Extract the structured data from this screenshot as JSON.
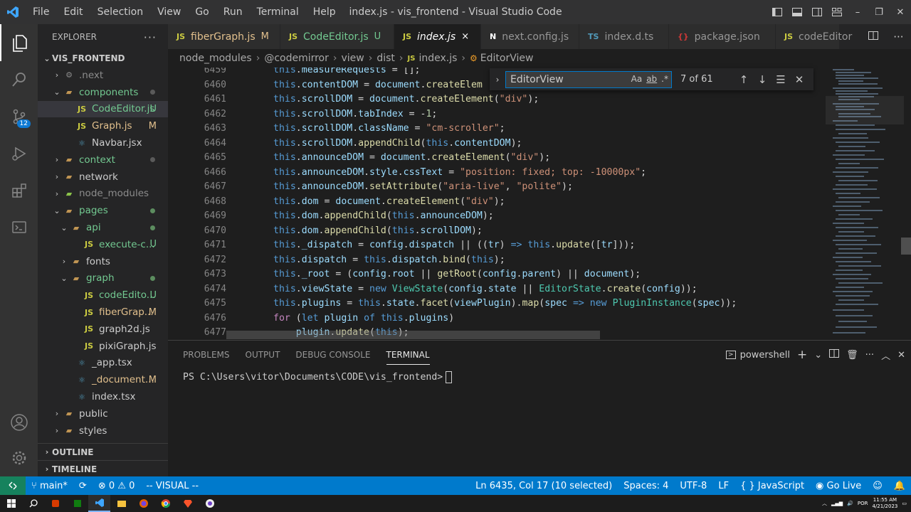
{
  "window": {
    "title": "index.js - vis_frontend - Visual Studio Code",
    "menu": [
      "File",
      "Edit",
      "Selection",
      "View",
      "Go",
      "Run",
      "Terminal",
      "Help"
    ]
  },
  "activity": {
    "scm_badge": "12"
  },
  "sidebar": {
    "header": "EXPLORER",
    "project": "VIS_FRONTEND",
    "tree": [
      {
        "label": ".next",
        "icon": "gear-folder-icon",
        "expanded": false,
        "mark": ""
      },
      {
        "label": "components",
        "icon": "folder-icon",
        "expanded": true,
        "mark": "dot"
      },
      {
        "label": "CodeEditor.js",
        "icon": "js-file-icon",
        "mark": "U",
        "selected": true
      },
      {
        "label": "Graph.js",
        "icon": "js-file-icon",
        "mark": "M"
      },
      {
        "label": "Navbar.jsx",
        "icon": "react-file-icon",
        "mark": ""
      },
      {
        "label": "context",
        "icon": "folder-icon",
        "expanded": false,
        "mark": "dot"
      },
      {
        "label": "network",
        "icon": "folder-icon",
        "expanded": false,
        "mark": ""
      },
      {
        "label": "node_modules",
        "icon": "node-folder-icon",
        "expanded": false,
        "mark": ""
      },
      {
        "label": "pages",
        "icon": "folder-icon",
        "expanded": true,
        "mark": "dot"
      },
      {
        "label": "api",
        "icon": "folder-icon",
        "expanded": true,
        "mark": "dot"
      },
      {
        "label": "execute-c...",
        "icon": "js-file-icon",
        "mark": "U"
      },
      {
        "label": "fonts",
        "icon": "folder-icon",
        "expanded": false,
        "mark": ""
      },
      {
        "label": "graph",
        "icon": "folder-icon",
        "expanded": true,
        "mark": "dot"
      },
      {
        "label": "codeEdito...",
        "icon": "js-file-icon",
        "mark": "U"
      },
      {
        "label": "fiberGrap...",
        "icon": "js-file-icon",
        "mark": "M"
      },
      {
        "label": "graph2d.js",
        "icon": "js-file-icon",
        "mark": ""
      },
      {
        "label": "pixiGraph.js",
        "icon": "js-file-icon",
        "mark": ""
      },
      {
        "label": "_app.tsx",
        "icon": "react-file-icon",
        "mark": ""
      },
      {
        "label": "_document...",
        "icon": "react-file-icon",
        "mark": "M"
      },
      {
        "label": "index.tsx",
        "icon": "react-file-icon",
        "mark": ""
      },
      {
        "label": "public",
        "icon": "folder-icon",
        "expanded": false,
        "mark": ""
      },
      {
        "label": "styles",
        "icon": "folder-icon",
        "expanded": false,
        "mark": ""
      }
    ],
    "outline": "OUTLINE",
    "timeline": "TIMELINE"
  },
  "tabs": [
    {
      "label": "fiberGraph.js",
      "icon": "JS",
      "mark": "M",
      "active": false
    },
    {
      "label": "CodeEditor.js",
      "icon": "JS",
      "mark": "U",
      "active": false
    },
    {
      "label": "index.js",
      "icon": "JS",
      "mark": "×",
      "active": true
    },
    {
      "label": "next.config.js",
      "icon": "N",
      "mark": "",
      "active": false
    },
    {
      "label": "index.d.ts",
      "icon": "TS",
      "mark": "",
      "active": false
    },
    {
      "label": "package.json",
      "icon": "{}",
      "mark": "",
      "active": false
    },
    {
      "label": "codeEditor",
      "icon": "JS",
      "mark": "",
      "active": false
    }
  ],
  "breadcrumb": [
    "node_modules",
    "@codemirror",
    "view",
    "dist",
    "index.js",
    "EditorView"
  ],
  "find": {
    "query": "EditorView",
    "opt_case": "Aa",
    "opt_word": "ab",
    "opt_regex": ".*",
    "count": "7 of 61"
  },
  "editor": {
    "line_numbers": [
      "6459",
      "6460",
      "6461",
      "6462",
      "6463",
      "6464",
      "6465",
      "6466",
      "6467",
      "6468",
      "6469",
      "6470",
      "6471",
      "6472",
      "6473",
      "6474",
      "6475",
      "6476",
      "6477"
    ]
  },
  "panel": {
    "tabs": [
      "PROBLEMS",
      "OUTPUT",
      "DEBUG CONSOLE",
      "TERMINAL"
    ],
    "active_tab": "TERMINAL",
    "shell": "powershell",
    "prompt": "PS C:\\Users\\vitor\\Documents\\CODE\\vis_frontend>"
  },
  "statusbar": {
    "branch": "main*",
    "errors": "0",
    "warnings": "0",
    "mode": "-- VISUAL --",
    "position": "Ln 6435, Col 17 (10 selected)",
    "spaces": "Spaces: 4",
    "encoding": "UTF-8",
    "eol": "LF",
    "language": "JavaScript",
    "golive": "Go Live"
  },
  "taskbar": {
    "lang": "POR",
    "time": "11:55 AM",
    "date": "4/21/2023"
  },
  "colors": {
    "accent": "#007acc",
    "sidebar": "#252526",
    "editor": "#1e1e1e"
  }
}
